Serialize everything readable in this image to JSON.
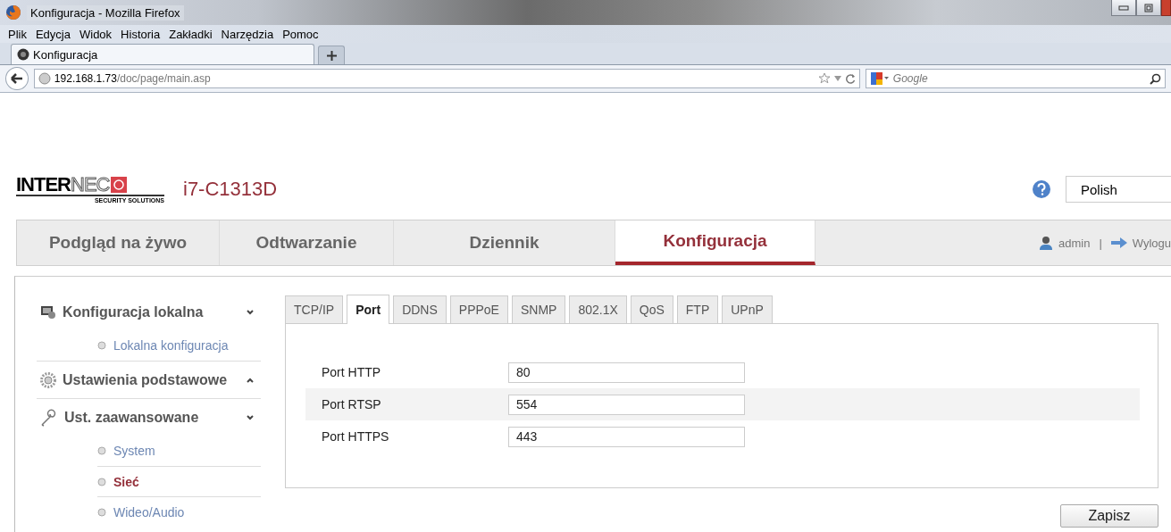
{
  "window": {
    "title": "Konfiguracja - Mozilla Firefox"
  },
  "menu": [
    "Plik",
    "Edycja",
    "Widok",
    "Historia",
    "Zakładki",
    "Narzędzia",
    "Pomoc"
  ],
  "browser_tabs": [
    {
      "label": "Konfiguracja",
      "selected": true
    }
  ],
  "address_bar": {
    "host": "192.168.1.73",
    "path": "/doc/page/main.asp"
  },
  "search": {
    "placeholder": "Google"
  },
  "header": {
    "logo": {
      "bold": "INTER",
      "light": "NEC",
      "tagline": "SECURITY SOLUTIONS"
    },
    "model": "i7-C1313D",
    "language": "Polish"
  },
  "nav": [
    {
      "label": "Podgląd na żywo",
      "selected": false
    },
    {
      "label": "Odtwarzanie",
      "selected": false
    },
    {
      "label": "Dziennik",
      "selected": false
    },
    {
      "label": "Konfiguracja",
      "selected": true
    }
  ],
  "user": {
    "name": "admin",
    "separator": "|",
    "logout": "Wylogu"
  },
  "sidebar": [
    {
      "label": "Konfiguracja lokalna",
      "kind": "local",
      "expanded": true,
      "children": [
        {
          "label": "Lokalna konfiguracja",
          "selected": false
        }
      ]
    },
    {
      "label": "Ustawienia podstawowe",
      "kind": "basic",
      "expanded": false
    },
    {
      "label": "Ust. zaawansowane",
      "kind": "advanced",
      "expanded": true,
      "children": [
        {
          "label": "System",
          "selected": false
        },
        {
          "label": "Sieć",
          "selected": true
        },
        {
          "label": "Wideo/Audio",
          "selected": false
        }
      ]
    }
  ],
  "tabs": [
    {
      "label": "TCP/IP",
      "selected": false
    },
    {
      "label": "Port",
      "selected": true
    },
    {
      "label": "DDNS",
      "selected": false
    },
    {
      "label": "PPPoE",
      "selected": false
    },
    {
      "label": "SNMP",
      "selected": false
    },
    {
      "label": "802.1X",
      "selected": false
    },
    {
      "label": "QoS",
      "selected": false
    },
    {
      "label": "FTP",
      "selected": false
    },
    {
      "label": "UPnP",
      "selected": false
    }
  ],
  "form": {
    "rows": [
      {
        "label": "Port HTTP",
        "value": "80",
        "highlighted": false
      },
      {
        "label": "Port RTSP",
        "value": "554",
        "highlighted": true
      },
      {
        "label": "Port HTTPS",
        "value": "443",
        "highlighted": false
      }
    ]
  },
  "buttons": [
    "Zapisz"
  ]
}
